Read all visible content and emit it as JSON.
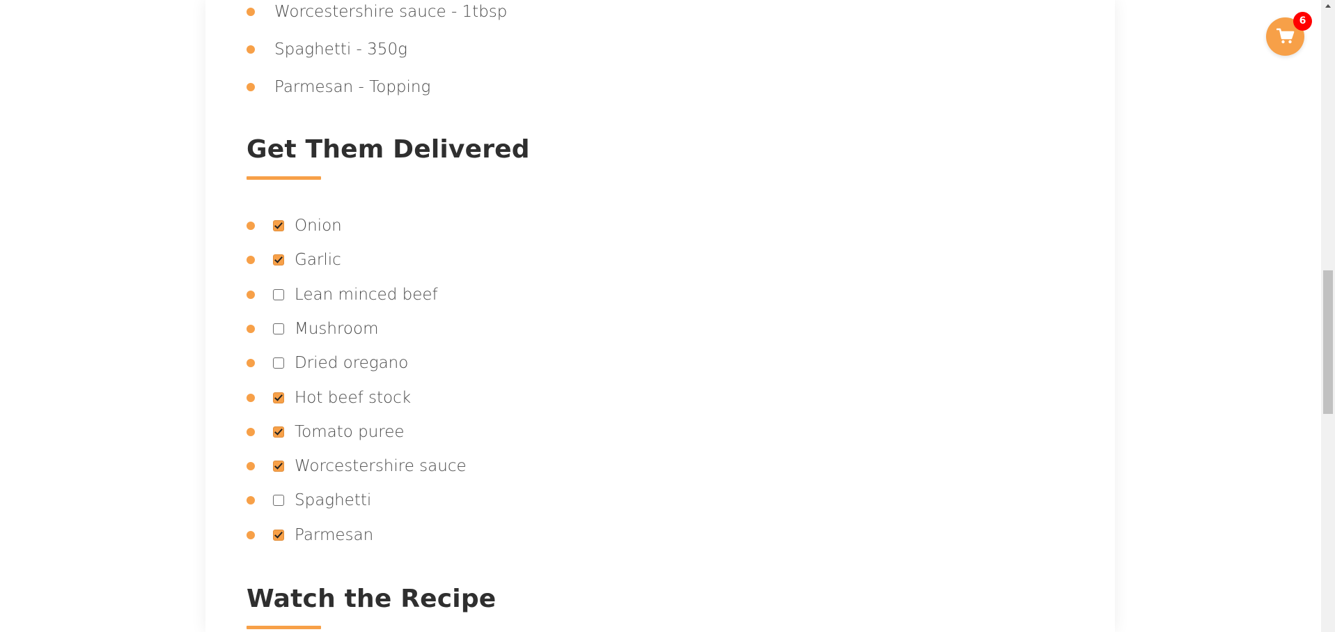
{
  "ingredients_tail": [
    "Worcestershire sauce - 1tbsp",
    "Spaghetti - 350g",
    "Parmesan - Topping"
  ],
  "delivery_section": {
    "title": "Get Them Delivered",
    "items": [
      {
        "label": "Onion",
        "checked": true
      },
      {
        "label": "Garlic",
        "checked": true
      },
      {
        "label": "Lean minced beef",
        "checked": false
      },
      {
        "label": "Mushroom",
        "checked": false
      },
      {
        "label": "Dried oregano",
        "checked": false
      },
      {
        "label": "Hot beef stock",
        "checked": true
      },
      {
        "label": "Tomato puree",
        "checked": true
      },
      {
        "label": "Worcestershire sauce",
        "checked": true
      },
      {
        "label": "Spaghetti",
        "checked": false
      },
      {
        "label": "Parmesan",
        "checked": true
      }
    ]
  },
  "recipe_section": {
    "title": "Watch the Recipe"
  },
  "cart": {
    "icon": "shopping-cart-icon",
    "count": "6"
  },
  "colors": {
    "accent": "#f7a048",
    "badge": "#ff0000",
    "heading": "#2f2f2f",
    "text": "#4a4a4a"
  }
}
